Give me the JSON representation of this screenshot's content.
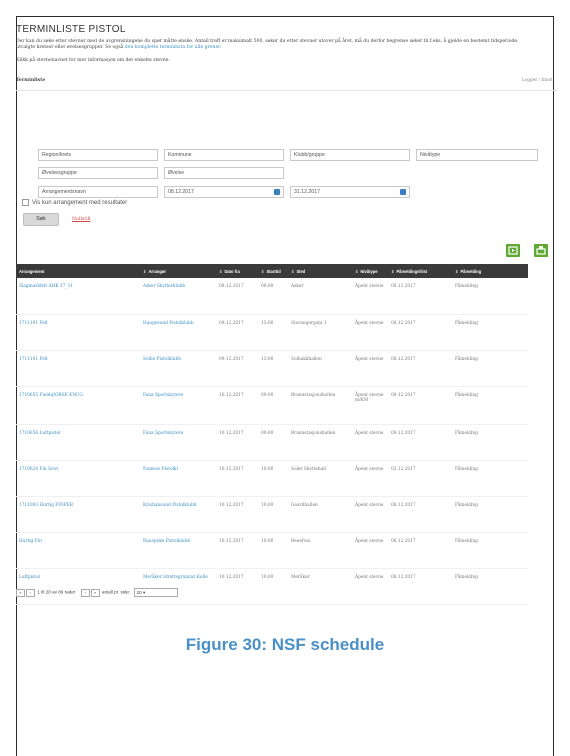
{
  "page": {
    "title": "TERMINLISTE PISTOL",
    "intro_text": "Der kan du søke etter stevner med de avgrensningene du spør måtte ønske. Antall treff er maksimalt 500, søker du etter stevner utover på året, må du derfor begrense søket til f.eks. å gjelde en bestemt tidsperiode, utvalgte kretser eller øvelsesgrupper. Se også",
    "intro_link": "den komplette terminlista for alle grener.",
    "hint": "Klikk på stevnenavnet for mer informasjon om det enkelte stevne."
  },
  "section": {
    "title": "Terminliste",
    "links": "Logger / Innst."
  },
  "filters": {
    "region": "Region/krets",
    "kommune": "Kommune",
    "klubb": "Klubb/gruppe",
    "niva": "Nivåtype",
    "ovelsesgruppe": "Øvelsesgruppe",
    "ovelse": "Øvelse",
    "arrangementsnavn": "Arrangementsnavn",
    "date_from": "08.12.2017",
    "date_to": "31.12.2017",
    "checkbox_label": "Vis kun arrangement med resultater",
    "search_button": "Søk",
    "reset_link": "Nullstill"
  },
  "toolbar": {
    "export_icon": "export-icon",
    "print_icon": "print-icon"
  },
  "table": {
    "headers": [
      "Arrangement",
      "Arrangør",
      "Dato fra",
      "Starttid",
      "Sted",
      "Nivåtype",
      "Påmeldingsfrist",
      "Påmelding"
    ],
    "rows": [
      [
        "Slagmarkfelt AHK 17_11",
        "Asker Skytterklubb",
        "08.12.2017",
        "08:00",
        "Asker",
        "Åpent stevne",
        "08.12.2017",
        "Påmelding"
      ],
      [
        "1711101 Felt",
        "Haugesund Pistolklubb",
        "09.12.2017",
        "13:00",
        "Storangergata 1",
        "Åpent stevne",
        "08.12.2017",
        "Påmelding"
      ],
      [
        "1711101 Felt",
        "Sollie Pistolklubb",
        "09.12.2017",
        "13:00",
        "Solbakkhallen",
        "Åpent stevne",
        "08.12.2017",
        "Påmelding"
      ],
      [
        "1710655 FieldqIORSE KNCG",
        "Fana Sportskytere",
        "10.12.2017",
        "09:00",
        "Brannstasjonshallen",
        "Åpent stevne m/KM",
        "09.12.2017",
        "Påmelding"
      ],
      [
        "1710656 Luftpistol",
        "Fana Sportskytere",
        "10.12.2017",
        "09:00",
        "Brannstasjonshallen",
        "Åpent stevne",
        "09.12.2017",
        "Påmelding"
      ],
      [
        "1710624 Fin Grov",
        "Namsos Pistolkl",
        "10.12.2017",
        "10:00",
        "Solør Skyttehall",
        "Åpent stevne",
        "02.12.2017",
        "Påmelding"
      ],
      [
        "1711083 Hurtig FINPER",
        "Kristiansund Pistolklubb",
        "10.12.2017",
        "10:00",
        "Gaardhallen",
        "Åpent stevne",
        "08.12.2017",
        "Påmelding"
      ],
      [
        "Hurtig Fin",
        "Rauspoke Pistolklubb",
        "10.12.2017",
        "10:00",
        "Benefoss",
        "Åpent stevne",
        "08.12.2017",
        "Påmelding"
      ],
      [
        "Luftpistol",
        "Meråker Idrettsgrunnat Kulle",
        "10.12.2017",
        "10:00",
        "Meråker",
        "Åpent stevne",
        "08.12.2017",
        "Påmelding"
      ]
    ]
  },
  "pager": {
    "range": "1 til 20 av 86 rader",
    "per_page_label": "antall pr. side:",
    "per_page_value": "20"
  },
  "caption": "Figure 30: NSF schedule",
  "colors": {
    "link": "#3a8fc2",
    "header_bg": "#3a3a3a",
    "icon_green": "#5ea833",
    "caption": "#4a90c8",
    "reset": "#d04848"
  }
}
